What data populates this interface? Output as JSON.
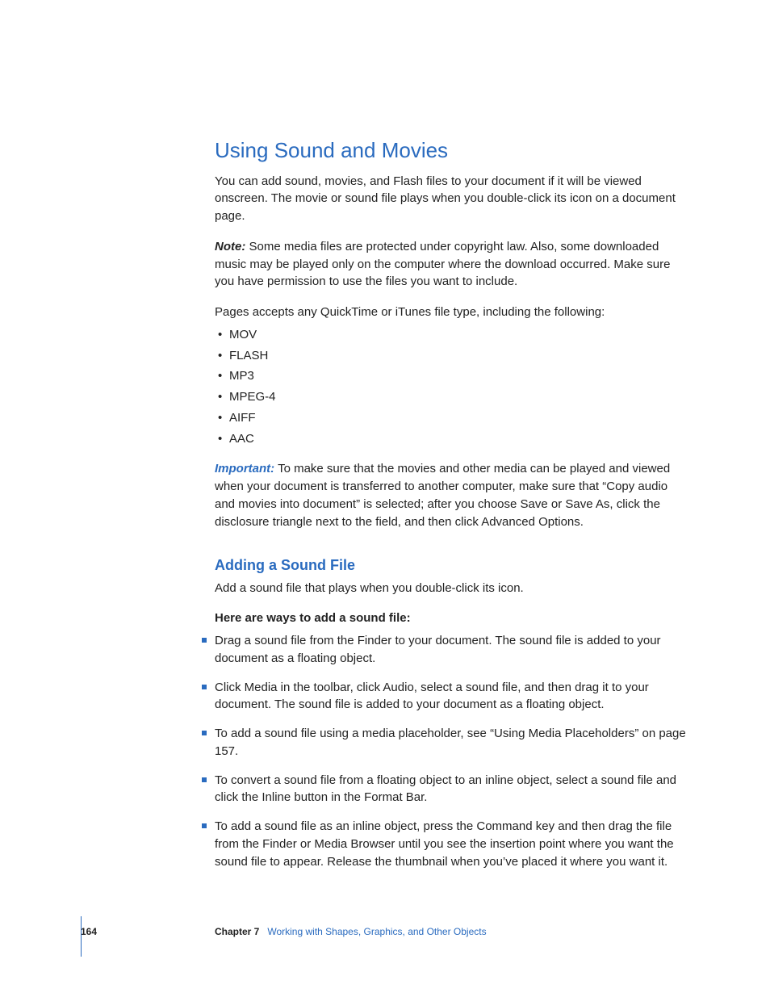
{
  "section": {
    "title": "Using Sound and Movies",
    "intro": "You can add sound, movies, and Flash files to your document if it will be viewed onscreen. The movie or sound file plays when you double-click its icon on a document page.",
    "note_label": "Note:",
    "note_body": "  Some media files are protected under copyright law. Also, some downloaded music may be played only on the computer where the download occurred. Make sure you have permission to use the files you want to include.",
    "accepts_line": "Pages accepts any QuickTime or iTunes file type, including the following:",
    "file_types": [
      "MOV",
      "FLASH",
      "MP3",
      "MPEG-4",
      "AIFF",
      "AAC"
    ],
    "important_label": "Important:",
    "important_body": "  To make sure that the movies and other media can be played and viewed when your document is transferred to another computer, make sure that “Copy audio and movies into document” is selected; after you choose Save or Save As, click the disclosure triangle next to the field, and then click Advanced Options."
  },
  "subsection": {
    "title": "Adding a Sound File",
    "intro": "Add a sound file that plays when you double-click its icon.",
    "ways_heading": "Here are ways to add a sound file:",
    "ways": [
      "Drag a sound file from the Finder to your document. The sound file is added to your document as a floating object.",
      "Click Media in the toolbar, click Audio, select a sound file, and then drag it to your document. The sound file is added to your document as a floating object.",
      "To add a sound file using a media placeholder, see “Using Media Placeholders” on page 157.",
      "To convert a sound file from a floating object to an inline object, select a sound file and click the Inline button in the Format Bar.",
      "To add a sound file as an inline object, press the Command key and then drag the file from the Finder or Media Browser until you see the insertion point where you want the sound file to appear. Release the thumbnail when you’ve placed it where you want it."
    ]
  },
  "footer": {
    "page": "164",
    "chapter_label": "Chapter 7",
    "chapter_name": "Working with Shapes, Graphics, and Other Objects"
  }
}
